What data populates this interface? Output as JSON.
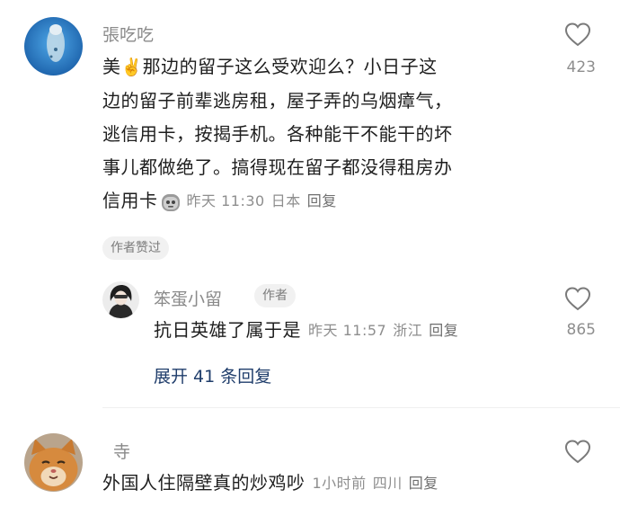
{
  "comments": [
    {
      "username": "張吃吃",
      "lines": [
        "美",
        "那边的留子这么受欢迎么？小日子这",
        "边的留子前辈逃房租，屋子弄的乌烟瘴气，",
        "逃信用卡，按揭手机。各种能干不能干的坏",
        "事儿都做绝了。搞得现在留子都没得租房办",
        "信用卡"
      ],
      "emoji_1": "✌️",
      "time": "昨天 11:30",
      "location": "日本",
      "reply_label": "回复",
      "likes": "423",
      "author_liked": "作者赞过"
    },
    {
      "username": "笨蛋小留",
      "author_badge": "作者",
      "text": "抗日英雄了属于是",
      "time": "昨天 11:57",
      "location": "浙江",
      "reply_label": "回复",
      "likes": "865"
    },
    {
      "username": "寺",
      "text": "外国人住隔壁真的炒鸡吵",
      "time": "1小时前",
      "location": "四川",
      "reply_label": "回复"
    }
  ],
  "expand_replies": "展开 41 条回复",
  "colors": {
    "link": "#1f3d6b",
    "meta": "#8e8e8e"
  }
}
